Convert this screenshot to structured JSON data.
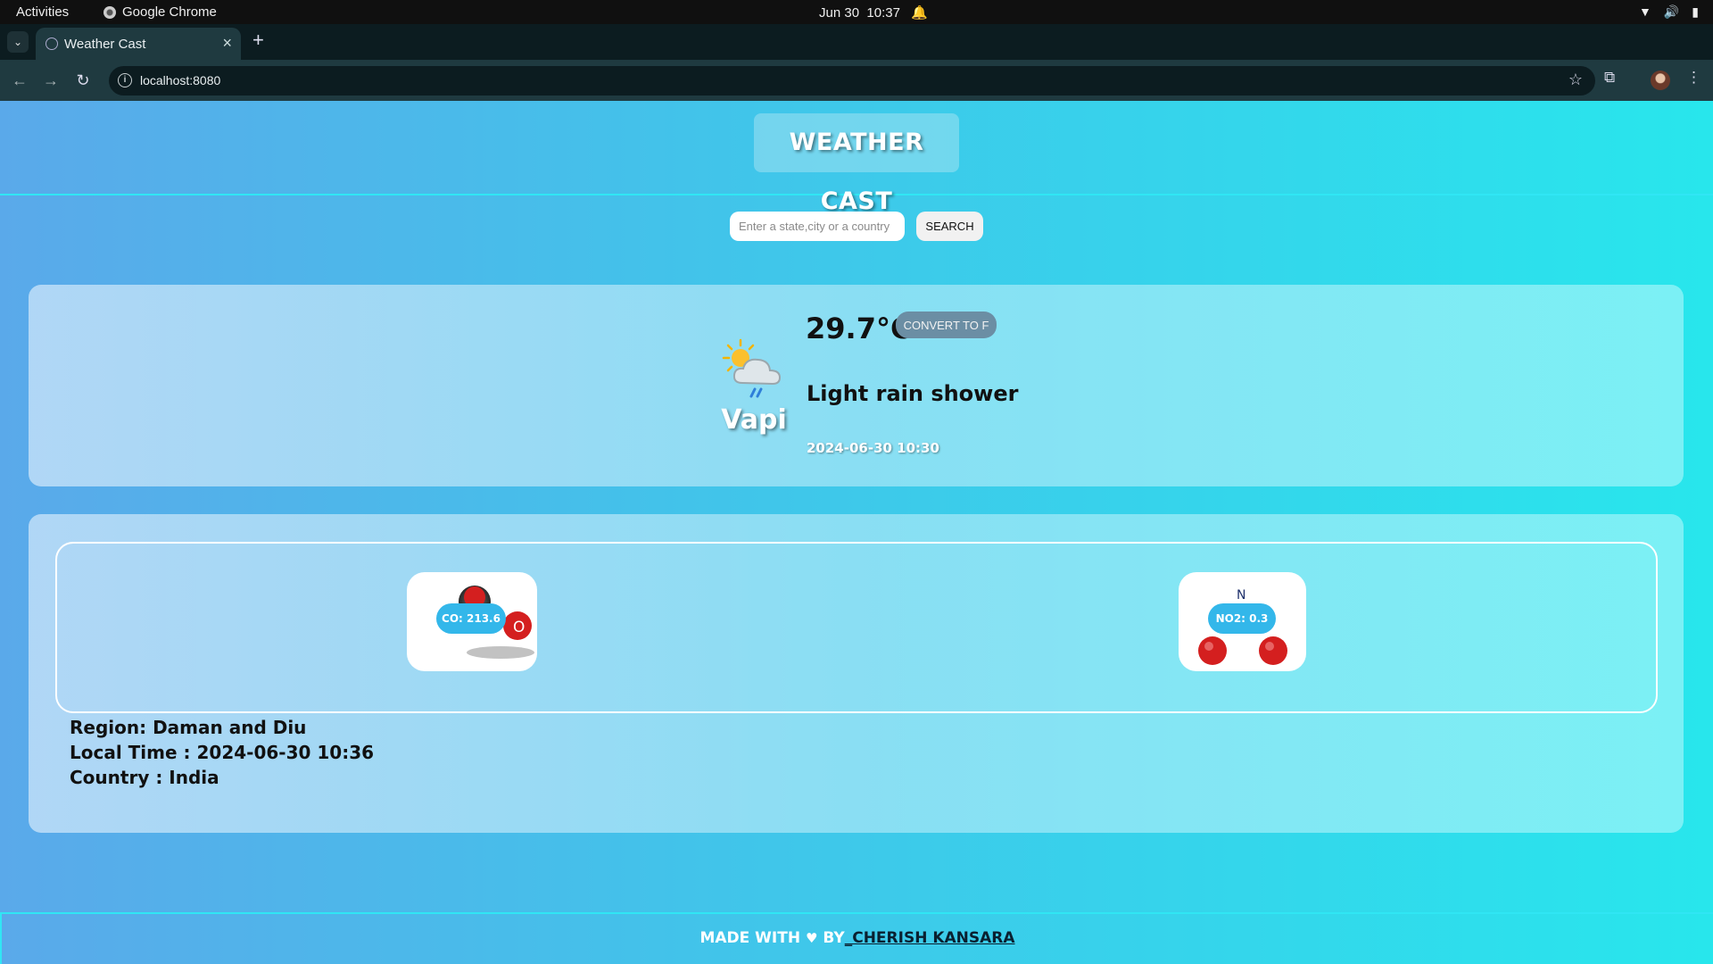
{
  "os": {
    "activities": "Activities",
    "app_name": "Google Chrome",
    "date": "Jun 30",
    "time": "10:37"
  },
  "browser": {
    "tab_title": "Weather Cast",
    "url": "localhost:8080"
  },
  "app": {
    "brand": "WEATHER CAST",
    "search": {
      "placeholder": "Enter a state,city or a country",
      "button": "SEARCH"
    },
    "current": {
      "icon": "sun-cloud-rain-icon",
      "city": "Vapi",
      "temperature": "29.7°C",
      "convert_button": "CONVERT TO F",
      "condition": "Light rain shower",
      "updated": "2024-06-30 10:30"
    },
    "air_quality": [
      {
        "name": "co-tile",
        "label": "CO: 213.6"
      },
      {
        "name": "no2-tile",
        "label": "NO2: 0.3"
      }
    ],
    "location": {
      "region": "Region: Daman and Diu",
      "local_time": "Local Time : 2024-06-30 10:36",
      "country": "Country : India"
    },
    "footer": {
      "prefix": "MADE WITH",
      "heart": "♥",
      "by": "BY",
      "author": "_CHERISH KANSARA"
    }
  }
}
